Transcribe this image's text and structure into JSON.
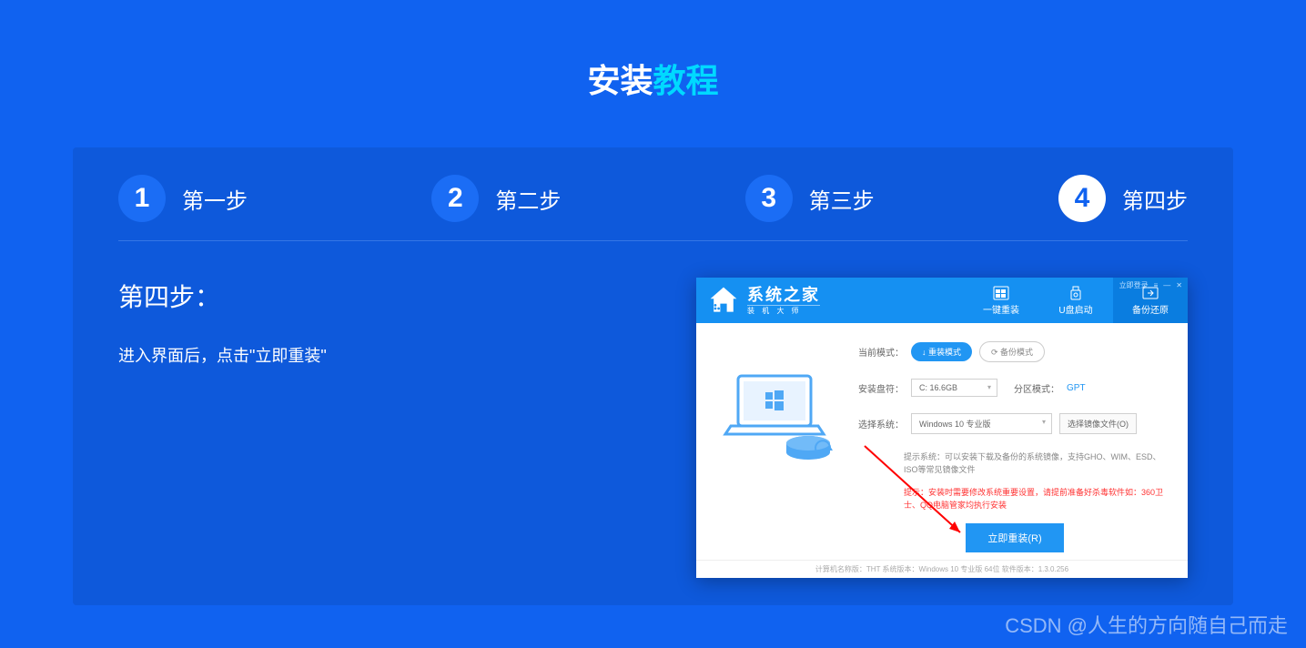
{
  "page": {
    "title_part1": "安装",
    "title_part2": "教程"
  },
  "steps": [
    {
      "num": "1",
      "label": "第一步",
      "active": false
    },
    {
      "num": "2",
      "label": "第二步",
      "active": false
    },
    {
      "num": "3",
      "label": "第三步",
      "active": false
    },
    {
      "num": "4",
      "label": "第四步",
      "active": true
    }
  ],
  "content": {
    "heading": "第四步：",
    "description": "进入界面后，点击\"立即重装\""
  },
  "screenshot": {
    "topbar": {
      "login": "立即登录",
      "menu": "≡",
      "min": "—",
      "close": "✕"
    },
    "logo": {
      "main": "系统之家",
      "sub": "装 机 大 师"
    },
    "tabs": [
      {
        "label": "一键重装",
        "active": false
      },
      {
        "label": "U盘启动",
        "active": false
      },
      {
        "label": "备份还原",
        "active": true
      }
    ],
    "form": {
      "mode_label": "当前模式：",
      "mode_a": "↓ 重装模式",
      "mode_b": "⟳ 备份模式",
      "drive_label": "安装盘符：",
      "drive_value": "C: 16.6GB",
      "partition_label": "分区模式：",
      "partition_value": "GPT",
      "system_label": "选择系统：",
      "system_value": "Windows 10 专业版",
      "browse_btn": "选择镜像文件(O)",
      "note": "提示系统：可以安装下载及备份的系统镜像，支持GHO、WIM、ESD、ISO等常见镜像文件",
      "warning": "提示：安装时需要修改系统重要设置，请提前准备好杀毒软件如：360卫士、QQ电脑管家均执行安装",
      "action_btn": "立即重装(R)"
    },
    "footer": "计算机名称版：THT  系统版本：Windows 10 专业版 64位  软件版本：1.3.0.256"
  },
  "watermark": "CSDN @人生的方向随自己而走"
}
